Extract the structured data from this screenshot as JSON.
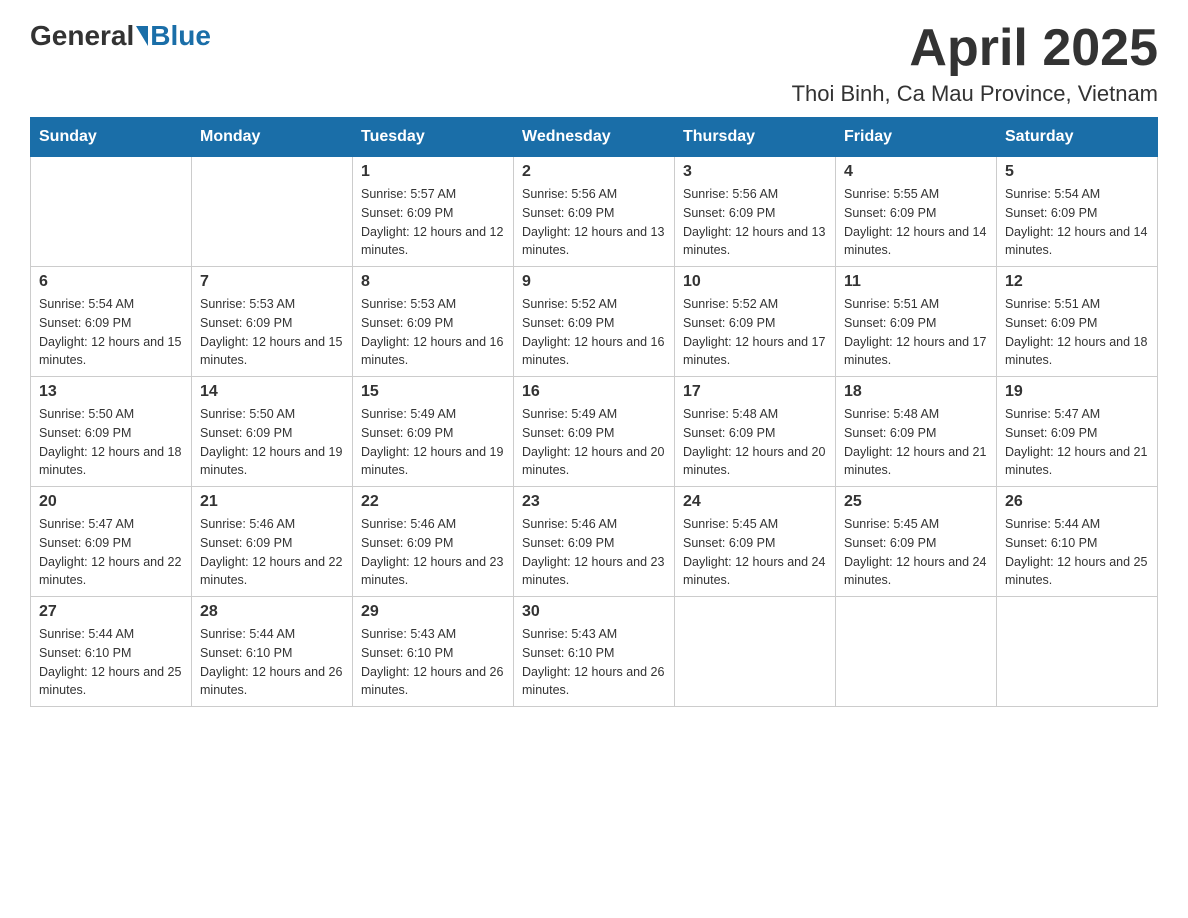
{
  "header": {
    "logo_general": "General",
    "logo_blue": "Blue",
    "month_title": "April 2025",
    "location": "Thoi Binh, Ca Mau Province, Vietnam"
  },
  "days_of_week": [
    "Sunday",
    "Monday",
    "Tuesday",
    "Wednesday",
    "Thursday",
    "Friday",
    "Saturday"
  ],
  "weeks": [
    [
      {
        "day": "",
        "sunrise": "",
        "sunset": "",
        "daylight": ""
      },
      {
        "day": "",
        "sunrise": "",
        "sunset": "",
        "daylight": ""
      },
      {
        "day": "1",
        "sunrise": "Sunrise: 5:57 AM",
        "sunset": "Sunset: 6:09 PM",
        "daylight": "Daylight: 12 hours and 12 minutes."
      },
      {
        "day": "2",
        "sunrise": "Sunrise: 5:56 AM",
        "sunset": "Sunset: 6:09 PM",
        "daylight": "Daylight: 12 hours and 13 minutes."
      },
      {
        "day": "3",
        "sunrise": "Sunrise: 5:56 AM",
        "sunset": "Sunset: 6:09 PM",
        "daylight": "Daylight: 12 hours and 13 minutes."
      },
      {
        "day": "4",
        "sunrise": "Sunrise: 5:55 AM",
        "sunset": "Sunset: 6:09 PM",
        "daylight": "Daylight: 12 hours and 14 minutes."
      },
      {
        "day": "5",
        "sunrise": "Sunrise: 5:54 AM",
        "sunset": "Sunset: 6:09 PM",
        "daylight": "Daylight: 12 hours and 14 minutes."
      }
    ],
    [
      {
        "day": "6",
        "sunrise": "Sunrise: 5:54 AM",
        "sunset": "Sunset: 6:09 PM",
        "daylight": "Daylight: 12 hours and 15 minutes."
      },
      {
        "day": "7",
        "sunrise": "Sunrise: 5:53 AM",
        "sunset": "Sunset: 6:09 PM",
        "daylight": "Daylight: 12 hours and 15 minutes."
      },
      {
        "day": "8",
        "sunrise": "Sunrise: 5:53 AM",
        "sunset": "Sunset: 6:09 PM",
        "daylight": "Daylight: 12 hours and 16 minutes."
      },
      {
        "day": "9",
        "sunrise": "Sunrise: 5:52 AM",
        "sunset": "Sunset: 6:09 PM",
        "daylight": "Daylight: 12 hours and 16 minutes."
      },
      {
        "day": "10",
        "sunrise": "Sunrise: 5:52 AM",
        "sunset": "Sunset: 6:09 PM",
        "daylight": "Daylight: 12 hours and 17 minutes."
      },
      {
        "day": "11",
        "sunrise": "Sunrise: 5:51 AM",
        "sunset": "Sunset: 6:09 PM",
        "daylight": "Daylight: 12 hours and 17 minutes."
      },
      {
        "day": "12",
        "sunrise": "Sunrise: 5:51 AM",
        "sunset": "Sunset: 6:09 PM",
        "daylight": "Daylight: 12 hours and 18 minutes."
      }
    ],
    [
      {
        "day": "13",
        "sunrise": "Sunrise: 5:50 AM",
        "sunset": "Sunset: 6:09 PM",
        "daylight": "Daylight: 12 hours and 18 minutes."
      },
      {
        "day": "14",
        "sunrise": "Sunrise: 5:50 AM",
        "sunset": "Sunset: 6:09 PM",
        "daylight": "Daylight: 12 hours and 19 minutes."
      },
      {
        "day": "15",
        "sunrise": "Sunrise: 5:49 AM",
        "sunset": "Sunset: 6:09 PM",
        "daylight": "Daylight: 12 hours and 19 minutes."
      },
      {
        "day": "16",
        "sunrise": "Sunrise: 5:49 AM",
        "sunset": "Sunset: 6:09 PM",
        "daylight": "Daylight: 12 hours and 20 minutes."
      },
      {
        "day": "17",
        "sunrise": "Sunrise: 5:48 AM",
        "sunset": "Sunset: 6:09 PM",
        "daylight": "Daylight: 12 hours and 20 minutes."
      },
      {
        "day": "18",
        "sunrise": "Sunrise: 5:48 AM",
        "sunset": "Sunset: 6:09 PM",
        "daylight": "Daylight: 12 hours and 21 minutes."
      },
      {
        "day": "19",
        "sunrise": "Sunrise: 5:47 AM",
        "sunset": "Sunset: 6:09 PM",
        "daylight": "Daylight: 12 hours and 21 minutes."
      }
    ],
    [
      {
        "day": "20",
        "sunrise": "Sunrise: 5:47 AM",
        "sunset": "Sunset: 6:09 PM",
        "daylight": "Daylight: 12 hours and 22 minutes."
      },
      {
        "day": "21",
        "sunrise": "Sunrise: 5:46 AM",
        "sunset": "Sunset: 6:09 PM",
        "daylight": "Daylight: 12 hours and 22 minutes."
      },
      {
        "day": "22",
        "sunrise": "Sunrise: 5:46 AM",
        "sunset": "Sunset: 6:09 PM",
        "daylight": "Daylight: 12 hours and 23 minutes."
      },
      {
        "day": "23",
        "sunrise": "Sunrise: 5:46 AM",
        "sunset": "Sunset: 6:09 PM",
        "daylight": "Daylight: 12 hours and 23 minutes."
      },
      {
        "day": "24",
        "sunrise": "Sunrise: 5:45 AM",
        "sunset": "Sunset: 6:09 PM",
        "daylight": "Daylight: 12 hours and 24 minutes."
      },
      {
        "day": "25",
        "sunrise": "Sunrise: 5:45 AM",
        "sunset": "Sunset: 6:09 PM",
        "daylight": "Daylight: 12 hours and 24 minutes."
      },
      {
        "day": "26",
        "sunrise": "Sunrise: 5:44 AM",
        "sunset": "Sunset: 6:10 PM",
        "daylight": "Daylight: 12 hours and 25 minutes."
      }
    ],
    [
      {
        "day": "27",
        "sunrise": "Sunrise: 5:44 AM",
        "sunset": "Sunset: 6:10 PM",
        "daylight": "Daylight: 12 hours and 25 minutes."
      },
      {
        "day": "28",
        "sunrise": "Sunrise: 5:44 AM",
        "sunset": "Sunset: 6:10 PM",
        "daylight": "Daylight: 12 hours and 26 minutes."
      },
      {
        "day": "29",
        "sunrise": "Sunrise: 5:43 AM",
        "sunset": "Sunset: 6:10 PM",
        "daylight": "Daylight: 12 hours and 26 minutes."
      },
      {
        "day": "30",
        "sunrise": "Sunrise: 5:43 AM",
        "sunset": "Sunset: 6:10 PM",
        "daylight": "Daylight: 12 hours and 26 minutes."
      },
      {
        "day": "",
        "sunrise": "",
        "sunset": "",
        "daylight": ""
      },
      {
        "day": "",
        "sunrise": "",
        "sunset": "",
        "daylight": ""
      },
      {
        "day": "",
        "sunrise": "",
        "sunset": "",
        "daylight": ""
      }
    ]
  ]
}
